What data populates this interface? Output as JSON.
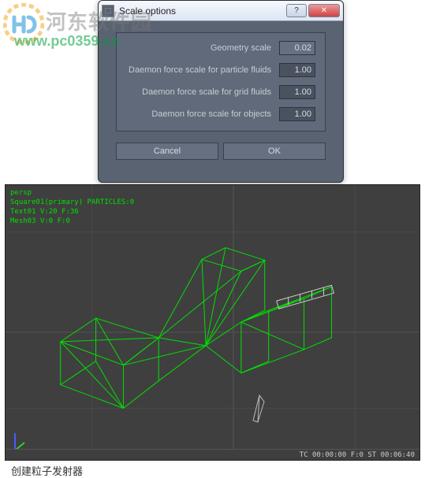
{
  "watermark": {
    "text": "河东软件园",
    "url": "www.pc0359.cn"
  },
  "dialog": {
    "title": "Scale options",
    "fields": [
      {
        "label": "Geometry scale",
        "value": "0.02"
      },
      {
        "label": "Daemon force scale for particle fluids",
        "value": "1.00"
      },
      {
        "label": "Daemon force scale for grid fluids",
        "value": "1.00"
      },
      {
        "label": "Daemon force scale for objects",
        "value": "1.00"
      }
    ],
    "buttons": {
      "cancel": "Cancel",
      "ok": "OK"
    },
    "winbtn": {
      "help": "?",
      "close": "✕"
    }
  },
  "viewport": {
    "hud": "persp\nSquare01(primary) PARTICLES:0\nText01 V:20 F:36\nMesh03 V:0 F:0",
    "status": "TC 00:00:00   F:0   ST 00:06:40"
  },
  "caption": "创建粒子发射器"
}
